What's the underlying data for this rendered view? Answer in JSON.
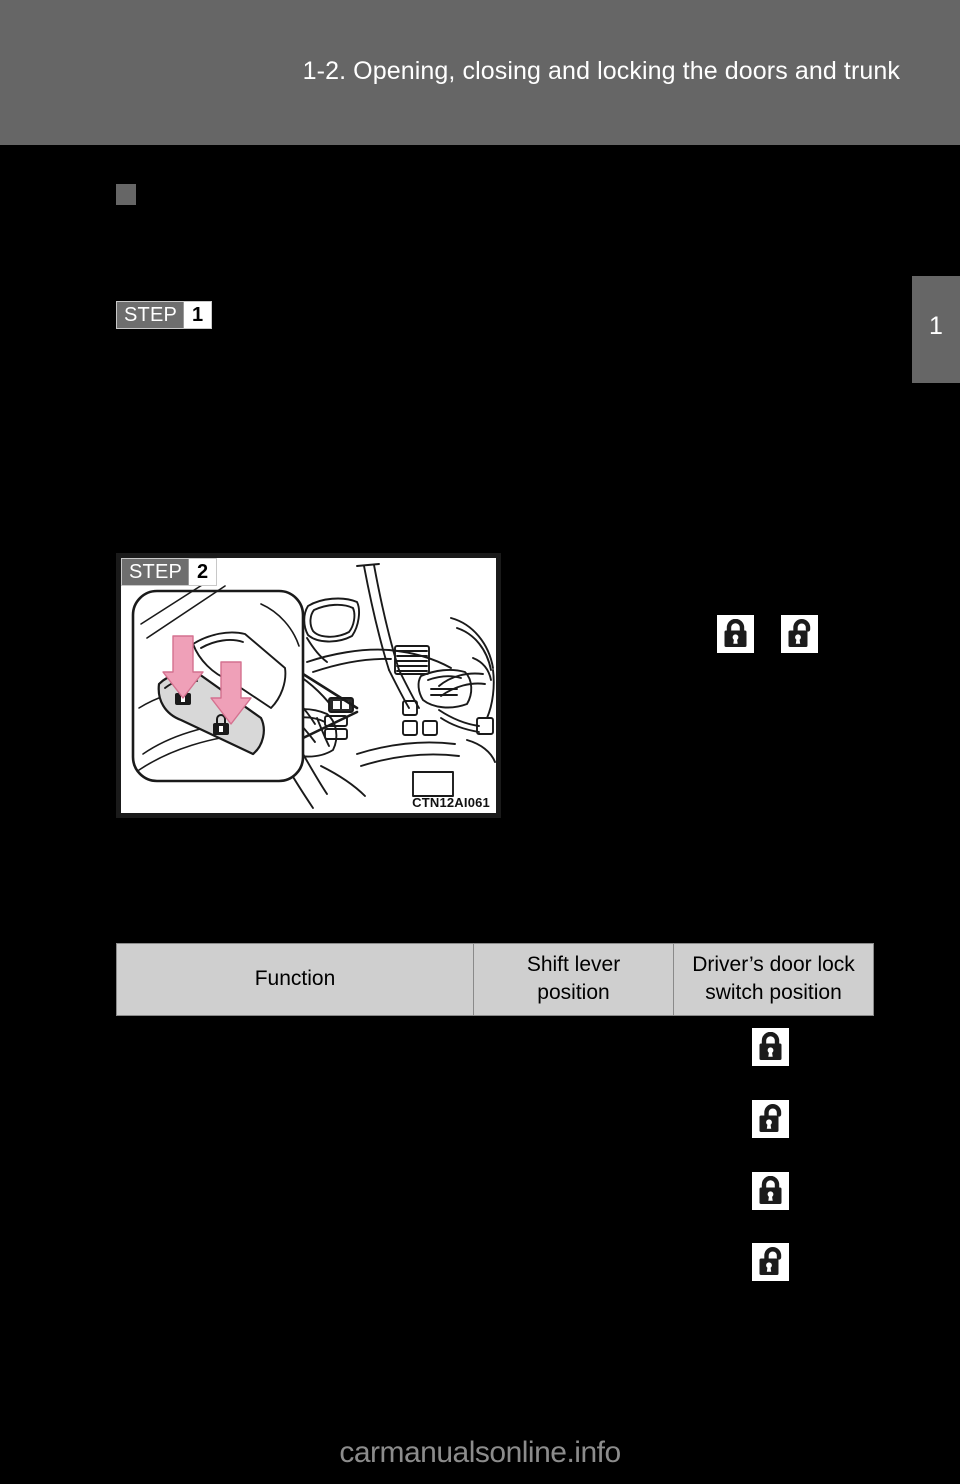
{
  "header": {
    "title": "1-2. Opening, closing and locking the doors and trunk"
  },
  "chapter_tab": {
    "number": "1"
  },
  "steps": [
    {
      "word": "STEP",
      "number": "1"
    },
    {
      "word": "STEP",
      "number": "2"
    }
  ],
  "figure": {
    "caption": "CTN12AI061",
    "description": "Vehicle interior view of driver's door lock switch with magnified callout and two pink arrows indicating lock and unlock press directions",
    "arrow_color": "#efa0b8",
    "switch_color": "#d8d8d8"
  },
  "inline_icons": [
    {
      "name": "lock-icon",
      "state": "locked"
    },
    {
      "name": "unlock-icon",
      "state": "unlocked"
    }
  ],
  "table": {
    "headers": {
      "function": "Function",
      "shift_lever": "Shift lever\nposition",
      "shift_lever_line1": "Shift lever",
      "shift_lever_line2": "position",
      "switch_position": "Driver’s door lock\nswitch position",
      "switch_position_line1": "Driver’s door lock",
      "switch_position_line2": "switch position"
    },
    "rows": [
      {
        "function": "",
        "shift_lever": "",
        "switch_icon": "locked"
      },
      {
        "function": "",
        "shift_lever": "",
        "switch_icon": "unlocked"
      },
      {
        "function": "",
        "shift_lever": "",
        "switch_icon": "locked"
      },
      {
        "function": "",
        "shift_lever": "",
        "switch_icon": "unlocked"
      }
    ]
  },
  "footer": {
    "watermark": "carmanualsonline.info"
  },
  "colors": {
    "header_bg": "#666666",
    "page_bg": "#000000",
    "table_header_bg": "#cfcfcf",
    "accent_pink": "#efa0b8",
    "watermark": "#8c8c8c"
  }
}
